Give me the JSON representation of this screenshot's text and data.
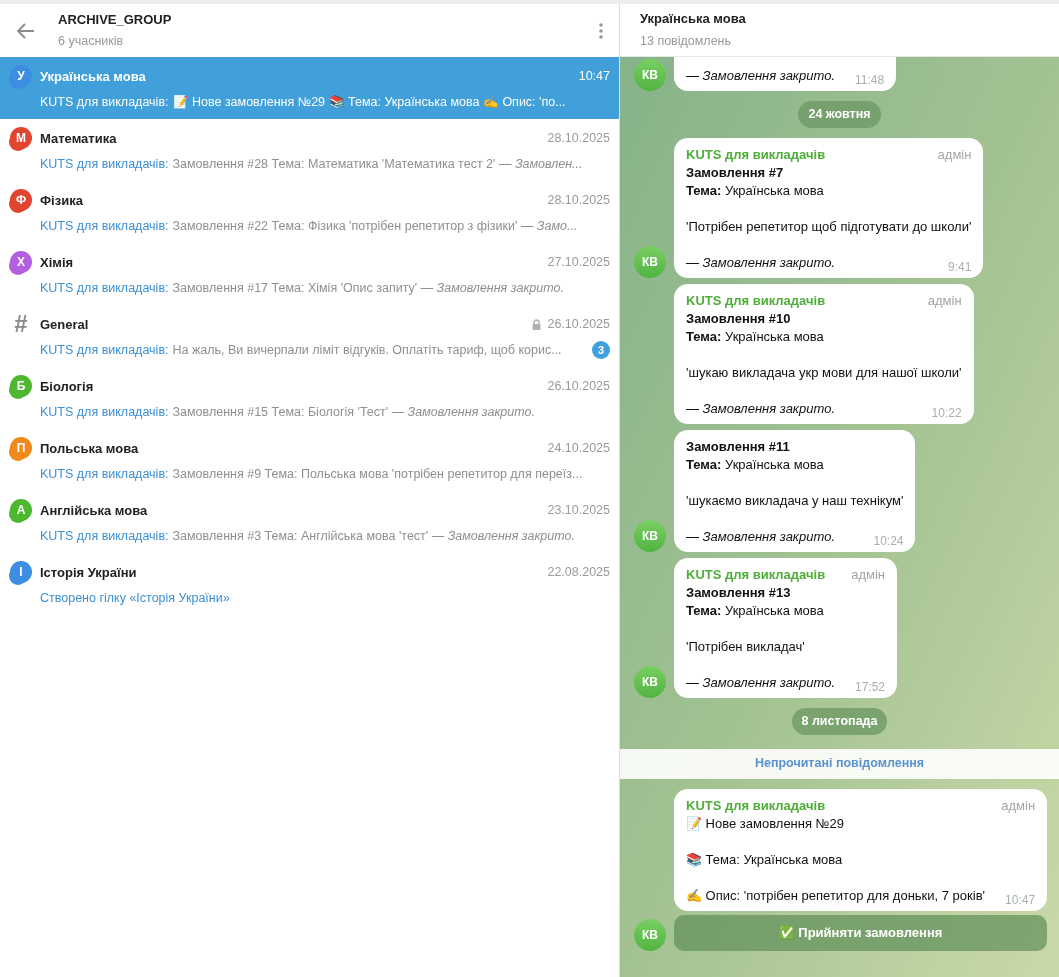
{
  "left_header": {
    "title": "ARCHIVE_GROUP",
    "subtitle": "6 учасників"
  },
  "topics": [
    {
      "kind": "bubble",
      "letter": "У",
      "color": "#3d8ee0",
      "name": "Українська мова",
      "time": "10:47",
      "sender": "KUTS для викладачів:",
      "preview": "📝 Нове замовлення №29  📚 Тема: Українська мова  ✍️ Опис: 'по...",
      "selected": true,
      "locked": false
    },
    {
      "kind": "bubble",
      "letter": "М",
      "color": "#e0452f",
      "name": "Математика",
      "time": "28.10.2025",
      "sender": "KUTS для викладачів:",
      "preview": "Замовлення #28 Тема: Математика  'Математика тест 2'  *— Замовлен...*",
      "selected": false,
      "locked": false
    },
    {
      "kind": "bubble",
      "letter": "Ф",
      "color": "#e0452f",
      "name": "Фізика",
      "time": "28.10.2025",
      "sender": "KUTS для викладачів:",
      "preview": "Замовлення #22 Тема: Фізика  'потрібен репетитор з фізики'  *— Замо...*",
      "selected": false,
      "locked": false
    },
    {
      "kind": "bubble",
      "letter": "Х",
      "color": "#b25ee0",
      "name": "Хімія",
      "time": "27.10.2025",
      "sender": "KUTS для викладачів:",
      "preview": "Замовлення #17 Тема: Хімія  'Опис запиту'  *— Замовлення закрито.*",
      "selected": false,
      "locked": false
    },
    {
      "kind": "hash",
      "letter": "#",
      "color": "#8a8a8a",
      "name": "General",
      "time": "26.10.2025",
      "sender": "KUTS для викладачів:",
      "preview": "На жаль, Ви вичерпали ліміт відгуків.  Оплатіть тариф, щоб корис...",
      "selected": false,
      "locked": true,
      "unread": "3"
    },
    {
      "kind": "bubble",
      "letter": "Б",
      "color": "#4db82e",
      "name": "Біологія",
      "time": "26.10.2025",
      "sender": "KUTS для викладачів:",
      "preview": "Замовлення #15 Тема: Біологія  'Тест'  *— Замовлення закрито.*",
      "selected": false,
      "locked": false
    },
    {
      "kind": "bubble",
      "letter": "П",
      "color": "#f08a1c",
      "name": "Польська мова",
      "time": "24.10.2025",
      "sender": "KUTS для викладачів:",
      "preview": "Замовлення #9 Тема: Польська мова  'потрібен репетитор для переїз...",
      "selected": false,
      "locked": false
    },
    {
      "kind": "bubble",
      "letter": "А",
      "color": "#4db82e",
      "name": "Англійська мова",
      "time": "23.10.2025",
      "sender": "KUTS для викладачів:",
      "preview": "Замовлення #3 Тема: Англійська мова  'тест'  *— Замовлення закрито.*",
      "selected": false,
      "locked": false
    },
    {
      "kind": "bubble",
      "letter": "І",
      "color": "#3d8ee0",
      "name": "Історія України",
      "time": "22.08.2025",
      "preview": "Створено гілку «Історія України»",
      "selected": false,
      "locked": false
    }
  ],
  "chat_header": {
    "title": "Українська мова",
    "subtitle": "13 повідомлень"
  },
  "messages": [
    {
      "kind": "message",
      "paragraphs": [
        [
          "*— Замовлення закрито.*"
        ]
      ],
      "time": "11:48",
      "avatar": "КВ"
    },
    {
      "kind": "date",
      "text": "24 жовтня"
    },
    {
      "kind": "message",
      "sender": "KUTS для викладачів",
      "role": "адмін",
      "paragraphs": [
        [
          "**Замовлення #7**",
          "**Тема:** Українська мова"
        ],
        [
          "'Потрібен репетитор щоб підготувати до школи'"
        ],
        [
          "*— Замовлення закрито.*"
        ]
      ],
      "time": "9:41",
      "avatar": "КВ"
    },
    {
      "kind": "message",
      "sender": "KUTS для викладачів",
      "role": "адмін",
      "paragraphs": [
        [
          "**Замовлення #10**",
          "**Тема:** Українська мова"
        ],
        [
          "'шукаю викладача укр мови для нашої школи'"
        ],
        [
          "*— Замовлення закрито.*"
        ]
      ],
      "time": "10:22"
    },
    {
      "kind": "message",
      "paragraphs": [
        [
          "**Замовлення #11**",
          "**Тема:** Українська мова"
        ],
        [
          "'шукаємо викладача у наш технікум'"
        ],
        [
          "*— Замовлення закрито.*"
        ]
      ],
      "time": "10:24",
      "avatar": "КВ"
    },
    {
      "kind": "message",
      "sender": "KUTS для викладачів",
      "role": "адмін",
      "paragraphs": [
        [
          "**Замовлення #13**",
          "**Тема:** Українська мова"
        ],
        [
          "'Потрібен викладач'"
        ],
        [
          "*— Замовлення закрито.*"
        ]
      ],
      "time": "17:52",
      "avatar": "КВ"
    },
    {
      "kind": "date",
      "text": "8 листопада"
    },
    {
      "kind": "divider",
      "text": "Непрочитані повідомлення"
    },
    {
      "kind": "message",
      "sender": "KUTS для викладачів",
      "role": "адмін",
      "paragraphs": [
        [
          "📝 Нове замовлення №29"
        ],
        [
          "📚 Тема: Українська мова"
        ],
        [
          "✍️ Опис: 'потрібен репетитор для доньки, 7 років'"
        ]
      ],
      "time": "10:47",
      "avatar": "КВ",
      "button": "✅ Прийняти замовлення"
    }
  ]
}
